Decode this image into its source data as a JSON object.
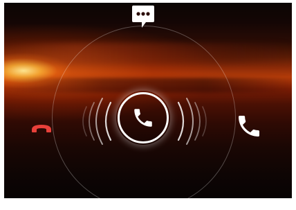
{
  "screen": {
    "type": "incoming-call-lock-screen"
  },
  "actions": {
    "message": {
      "icon": "speech-bubble-icon",
      "color": "#ffffff"
    },
    "decline": {
      "icon": "phone-hangup-icon",
      "color": "#e8403a"
    },
    "answer": {
      "icon": "phone-icon",
      "color": "#ffffff"
    },
    "center": {
      "icon": "phone-icon",
      "color": "#ffffff"
    }
  }
}
